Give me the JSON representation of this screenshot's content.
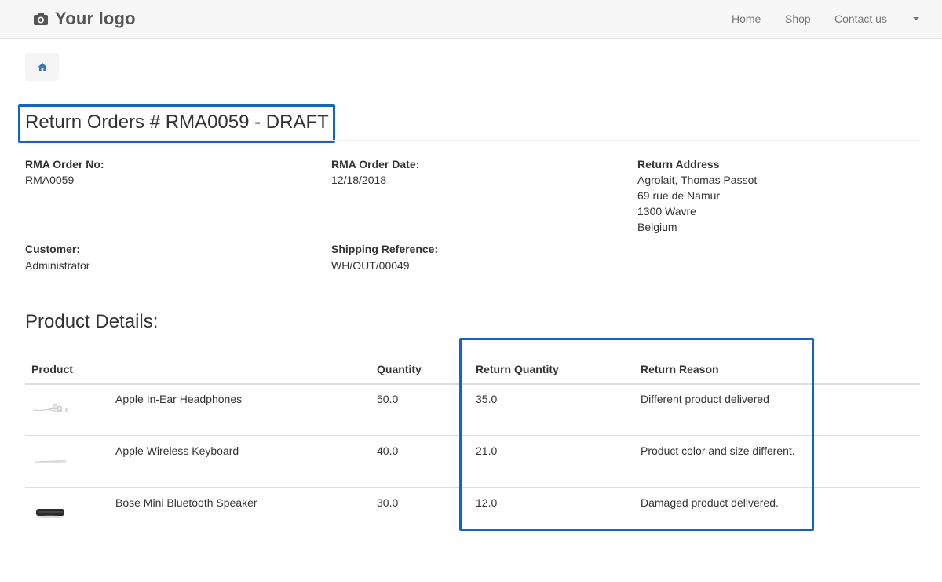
{
  "navbar": {
    "logo_text": "Your logo",
    "links": [
      "Home",
      "Shop",
      "Contact us"
    ]
  },
  "page": {
    "title": "Return Orders # RMA0059 - DRAFT"
  },
  "info": {
    "rma_no_label": "RMA Order No:",
    "rma_no_value": "RMA0059",
    "rma_date_label": "RMA Order Date:",
    "rma_date_value": "12/18/2018",
    "return_address_label": "Return Address",
    "return_address_lines": [
      "Agrolait, Thomas Passot",
      "69 rue de Namur",
      "1300 Wavre",
      "Belgium"
    ],
    "customer_label": "Customer:",
    "customer_value": "Administrator",
    "shipping_ref_label": "Shipping Reference:",
    "shipping_ref_value": "WH/OUT/00049"
  },
  "product_section": {
    "title": "Product Details:",
    "headers": {
      "product": "Product",
      "quantity": "Quantity",
      "return_quantity": "Return Quantity",
      "return_reason": "Return Reason"
    },
    "rows": [
      {
        "thumb": "earphones-image",
        "name": "Apple In-Ear Headphones",
        "quantity": "50.0",
        "return_quantity": "35.0",
        "reason": "Different product delivered"
      },
      {
        "thumb": "keyboard-image",
        "name": "Apple Wireless Keyboard",
        "quantity": "40.0",
        "return_quantity": "21.0",
        "reason": "Product color and size different."
      },
      {
        "thumb": "speaker-image",
        "name": "Bose Mini Bluetooth Speaker",
        "quantity": "30.0",
        "return_quantity": "12.0",
        "reason": "Damaged product delivered."
      }
    ]
  },
  "colors": {
    "highlight": "#1565c0",
    "home_icon": "#337ab7"
  }
}
